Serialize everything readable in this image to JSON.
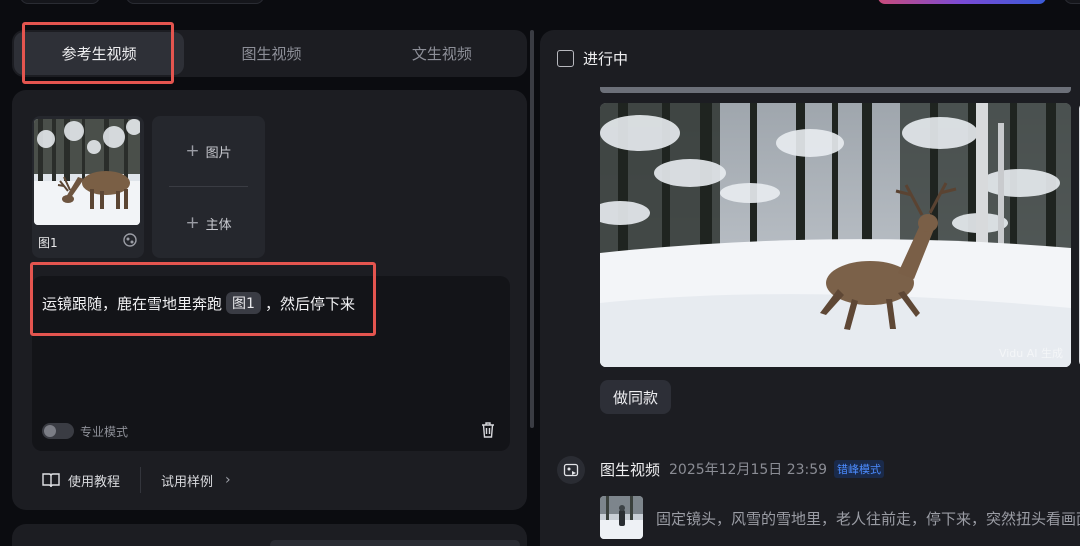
{
  "tabs": [
    {
      "label": "参考生视频",
      "active": true
    },
    {
      "label": "图生视频",
      "active": false
    },
    {
      "label": "文生视频",
      "active": false
    }
  ],
  "reference": {
    "image_label": "图1",
    "add_image_label": "图片",
    "add_subject_label": "主体"
  },
  "prompt": {
    "text_before": "运镜跟随，鹿在雪地里奔跑",
    "chip": "图1",
    "text_after": "，然后停下来"
  },
  "pro_mode_label": "专业模式",
  "footer": {
    "tutorial_label": "使用教程",
    "examples_label": "试用样例"
  },
  "right": {
    "in_progress_label": "进行中",
    "watermark": "Vidu AI 生成",
    "make_same_label": "做同款",
    "task": {
      "title": "图生视频",
      "time": "2025年12月15日 23:59",
      "badge": "错峰模式",
      "description": "固定镜头，风雪的雪地里，老人往前走，停下来，突然扭头看画面"
    }
  },
  "colors": {
    "highlight": "#e4554f",
    "badge_text": "#4c8cff",
    "panel_bg": "#1c1d22",
    "page_bg": "#0b0c10"
  }
}
